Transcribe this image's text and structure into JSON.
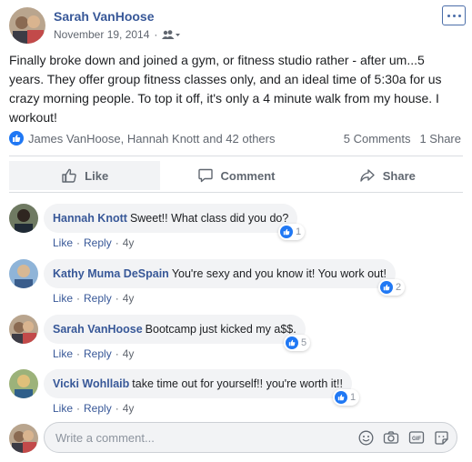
{
  "post": {
    "author": "Sarah VanHoose",
    "date": "November 19, 2014",
    "separator": "·",
    "audience_icon": "friends-icon",
    "text": "Finally broke down and joined a gym, or fitness studio rather - after um...5 years. They offer group fitness classes only, and an ideal time of 5:30a for us crazy morning people. To top it off, it's only a 4 minute walk from my house. I workout!",
    "reactions_summary": "James VanHoose, Hannah Knott and 42 others",
    "comments_count": "5 Comments",
    "shares_count": "1 Share"
  },
  "actions": {
    "like": "Like",
    "comment": "Comment",
    "share": "Share"
  },
  "comments": [
    {
      "name": "Hannah Knott",
      "text": "Sweet!! What class did you do?",
      "likes": "1",
      "like": "Like",
      "reply": "Reply",
      "time": "4y"
    },
    {
      "name": "Kathy Muma DeSpain",
      "text": "You're sexy and you know it! You work out!",
      "likes": "2",
      "like": "Like",
      "reply": "Reply",
      "time": "4y"
    },
    {
      "name": "Sarah VanHoose",
      "text": "Bootcamp just kicked my a$$.",
      "likes": "5",
      "like": "Like",
      "reply": "Reply",
      "time": "4y"
    },
    {
      "name": "Vicki Wohllaib",
      "text": "take time out for yourself!! you're worth it!!",
      "likes": "1",
      "like": "Like",
      "reply": "Reply",
      "time": "4y"
    }
  ],
  "composer": {
    "placeholder": "Write a comment..."
  },
  "colors": {
    "link": "#385898",
    "like_blue": "#2078f4",
    "bubble_bg": "#f2f3f5"
  }
}
